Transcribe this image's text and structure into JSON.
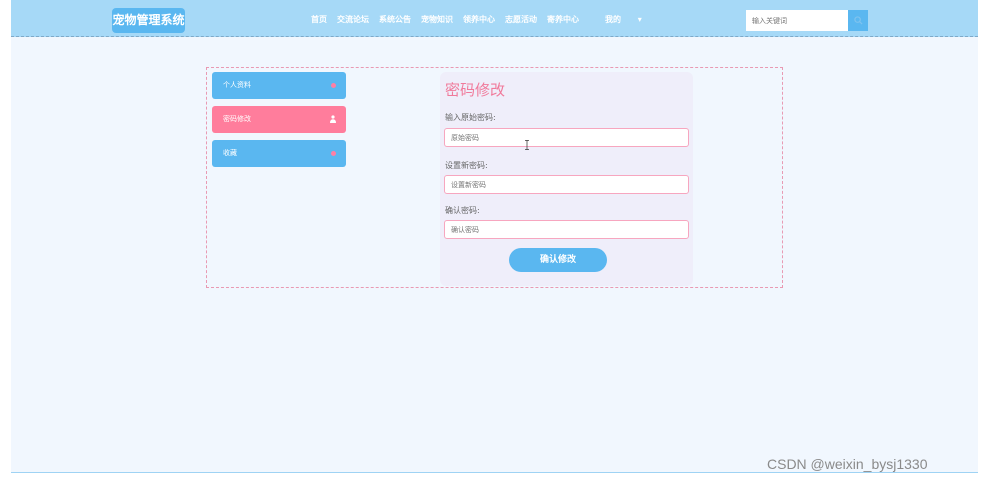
{
  "header": {
    "logo": "宠物管理系统",
    "nav": [
      "首页",
      "交流论坛",
      "系统公告",
      "宠物知识",
      "领养中心",
      "志愿活动",
      "寄养中心"
    ],
    "user_menu": "我的",
    "user_menu_caret": "▾",
    "search_placeholder": "输入关键词"
  },
  "sidebar": {
    "items": [
      {
        "label": "个人资料",
        "active": false
      },
      {
        "label": "密码修改",
        "active": true
      },
      {
        "label": "收藏",
        "active": false
      }
    ]
  },
  "form": {
    "title": "密码修改",
    "old_label": "输入原始密码:",
    "old_placeholder": "原始密码",
    "new_label": "设置新密码:",
    "new_placeholder": "设置新密码",
    "confirm_label": "确认密码:",
    "confirm_placeholder": "确认密码",
    "submit": "确认修改"
  },
  "watermark": "CSDN @weixin_bysj1330",
  "colors": {
    "header_bg": "#a6d9f7",
    "primary_blue": "#5ab7f0",
    "accent_pink": "#ff7d9c",
    "title_pink": "#f07a9b",
    "page_bg": "#f1f7fe"
  }
}
